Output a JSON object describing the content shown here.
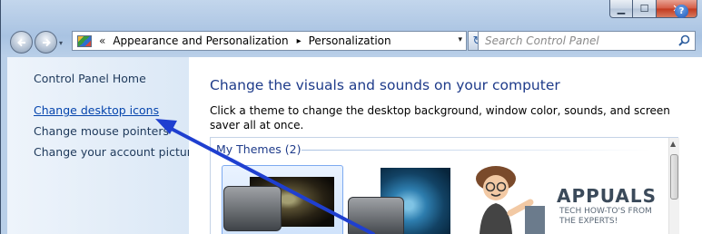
{
  "window": {
    "caption": {
      "minimize": "▁",
      "maximize": "☐",
      "close": "✕"
    }
  },
  "nav": {
    "back_icon": "back-arrow-icon",
    "forward_icon": "forward-arrow-icon",
    "history_icon": "▾",
    "breadcrumb_chevron": "«",
    "breadcrumb": [
      "Appearance and Personalization",
      "Personalization"
    ],
    "breadcrumb_sep": "▸",
    "dropdown_icon": "▾",
    "refresh_icon": "↻",
    "search_placeholder": "Search Control Panel"
  },
  "sidebar": {
    "items": [
      {
        "label": "Control Panel Home"
      },
      {
        "label": "Change desktop icons"
      },
      {
        "label": "Change mouse pointers"
      },
      {
        "label": "Change your account picture"
      }
    ]
  },
  "main": {
    "help_icon": "?",
    "title": "Change the visuals and sounds on your computer",
    "description": "Click a theme to change the desktop background, window color, sounds, and screen saver all at once.",
    "themes_group": "My Themes (2)"
  },
  "watermark": {
    "title": "APPUALS",
    "subtitle_line1": "TECH HOW-TO'S FROM",
    "subtitle_line2": "THE EXPERTS!"
  },
  "colors": {
    "arrow": "#1f3fd0",
    "link": "#0645ad",
    "title": "#1e3b8a"
  }
}
